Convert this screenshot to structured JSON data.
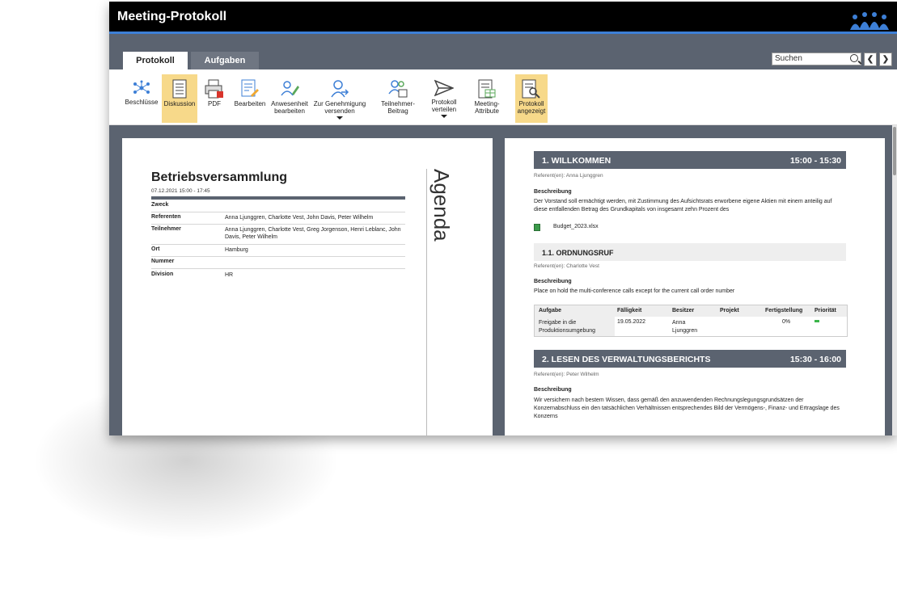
{
  "window": {
    "title": "Meeting-Protokoll"
  },
  "tabs": [
    {
      "label": "Protokoll",
      "active": true
    },
    {
      "label": "Aufgaben",
      "active": false
    }
  ],
  "search": {
    "placeholder": "Suchen",
    "prev": "❮",
    "next": "❯"
  },
  "toolbar": [
    {
      "label": "Beschlüsse",
      "icon": "network-icon",
      "highlighted": false
    },
    {
      "label": "Diskussion",
      "icon": "document-lines-icon",
      "highlighted": true
    },
    {
      "label": "PDF",
      "icon": "pdf-print-icon",
      "highlighted": false
    },
    {
      "label": "Bearbeiten",
      "icon": "edit-document-icon",
      "highlighted": false
    },
    {
      "label": "Anwesenheit bearbeiten",
      "icon": "users-edit-icon",
      "highlighted": false
    },
    {
      "label": "Zur Genehmigung versenden",
      "icon": "user-send-icon",
      "highlighted": false,
      "dropdown": true
    },
    {
      "label": "Teilnehmer-Beitrag",
      "icon": "users-table-icon",
      "highlighted": false
    },
    {
      "label": "Protokoll verteilen",
      "icon": "paper-plane-icon",
      "highlighted": false,
      "dropdown": true
    },
    {
      "label": "Meeting-Attribute",
      "icon": "attributes-icon",
      "highlighted": false
    },
    {
      "label": "Protokoll angezeigt",
      "icon": "document-search-icon",
      "highlighted": true
    }
  ],
  "meeting": {
    "title": "Betriebsversammlung",
    "datetime": "07.12.2021 15:00 - 17:45",
    "rows": [
      {
        "key": "Zweck",
        "value": ""
      },
      {
        "key": "Referenten",
        "value": "Anna Ljunggren, Charlotte Vest, John Davis, Peter Wilhelm"
      },
      {
        "key": "Teilnehmer",
        "value": "Anna Ljunggren, Charlotte Vest, Greg Jorgenson, Henri Leblanc, John Davis, Peter Wilhelm"
      },
      {
        "key": "Ort",
        "value": "Hamburg"
      },
      {
        "key": "Nummer",
        "value": ""
      },
      {
        "key": "Division",
        "value": "HR"
      }
    ],
    "agenda_label": "Agenda"
  },
  "agenda": {
    "s1": {
      "title": "1. WILLKOMMEN",
      "time": "15:00 - 15:30",
      "referent": "Referent(en): Anna Ljunggren",
      "desc_label": "Beschreibung",
      "desc": "Der Vorstand soll ermächtigt werden, mit Zustimmung des Aufsichtsrats erworbene eigene Aktien mit einem anteilig auf diese entfallenden Betrag des Grundkapitals von insgesamt zehn Prozent des",
      "file": "Budget_2023.xlsx"
    },
    "s11": {
      "title": "1.1. ORDNUNGSRUF",
      "referent": "Referent(en): Charlotte Vest",
      "desc_label": "Beschreibung",
      "desc": "Place on hold the multi-conference calls except for the current call order number",
      "task_headers": [
        "Aufgabe",
        "Fälligkeit",
        "Besitzer",
        "Projekt",
        "Fertigstellung",
        "Priorität"
      ],
      "task": {
        "aufgabe": "Freigabe in die Produktionsumgebung",
        "faelligkeit": "19.05.2022",
        "besitzer": "Anna Ljunggren",
        "projekt": "",
        "fertigstellung": "0%"
      }
    },
    "s2": {
      "title": "2. LESEN DES VERWALTUNGSBERICHTS",
      "time": "15:30 - 16:00",
      "referent": "Referent(en): Peter Wilhelm",
      "desc_label": "Beschreibung",
      "desc": "Wir versichern nach bestem Wissen, dass gemäß den anzuwendenden Rechnungslegungsgrundsätzen der Konzernabschluss ein den tatsächlichen Verhältnissen entsprechendes Bild der Vermögens-, Finanz- und Ertragslage des Konzerns"
    }
  },
  "colors": {
    "accent": "#3d7fd6",
    "panel": "#5b6370",
    "highlight": "#f7d98a",
    "priority": "#3bb54a"
  }
}
